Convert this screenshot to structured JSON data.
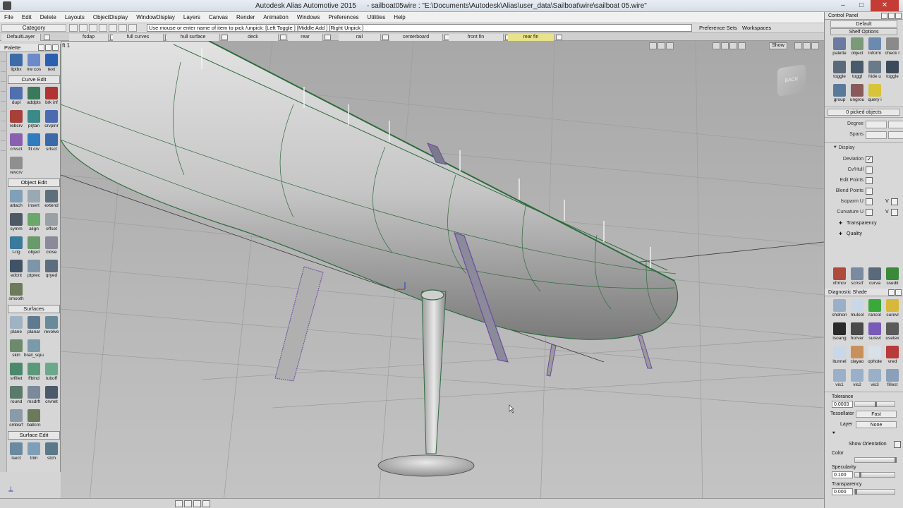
{
  "window": {
    "app_title": "Autodesk Alias Automotive 2015",
    "file_title": "- sailboat05wire : \"E:\\Documents\\Autodesk\\Alias\\user_data\\Sailboat\\wire\\sailboat 05.wire\"",
    "minimize": "–",
    "maximize": "□",
    "close": "✕"
  },
  "menu": [
    "File",
    "Edit",
    "Delete",
    "Layouts",
    "ObjectDisplay",
    "WindowDisplay",
    "Layers",
    "Canvas",
    "Render",
    "Animation",
    "Windows",
    "Preferences",
    "Utilities",
    "Help"
  ],
  "prompt_row": {
    "category": "Category",
    "prompt": "Use mouse or enter name of item to pick /unpick: [Left Toggle ] [Middle Add ] [Right Unpick ]",
    "preference_sets": "Preference Sets",
    "workspaces": "Workspaces"
  },
  "shelf_row": {
    "default_layer": "DefaultLayer",
    "tabs": [
      "fsdap",
      "full curves",
      "hull surface",
      "deck",
      "rear",
      "rail",
      "centerboard",
      "front fin",
      "rear fin"
    ],
    "active_tab": "rear fin"
  },
  "viewport": {
    "label": "ft  1",
    "show_button": "Show",
    "viewcube_label": "BACK"
  },
  "palette": {
    "title": "Palette",
    "top_tools": [
      {
        "icon": "liptbx-icon",
        "label": "liptbx",
        "color": "#3d6ba8"
      },
      {
        "icon": "nw-cos-icon",
        "label": "nw cos",
        "color": "#6b8ac9"
      },
      {
        "icon": "text-icon",
        "label": "text",
        "color": "#2b5fb0"
      }
    ],
    "sections": [
      {
        "title": "Curve Edit",
        "tools": [
          {
            "icon": "dupl-icon",
            "label": "dupl",
            "color": "#4f6fae"
          },
          {
            "icon": "addpts-icon",
            "label": "addpts",
            "color": "#3a7a5a"
          },
          {
            "icon": "brkinf-icon",
            "label": "brk inf",
            "color": "#b03434"
          },
          {
            "icon": "rebcrv-icon",
            "label": "rebcrv",
            "color": "#a8403a"
          },
          {
            "icon": "prjtan-icon",
            "label": "prjtan",
            "color": "#3b8a8a"
          },
          {
            "icon": "crvplnr-icon",
            "label": "crvplnr",
            "color": "#4a6bb0"
          },
          {
            "icon": "crvsct-icon",
            "label": "crvsct",
            "color": "#8a5fb0"
          },
          {
            "icon": "fitcrv-icon",
            "label": "fit crv",
            "color": "#2f7bbf"
          },
          {
            "icon": "srtsct-icon",
            "label": "srtsct",
            "color": "#3a6aa8"
          },
          {
            "icon": "revcrv-icon",
            "label": "revcrv",
            "color": "#8f8f8f"
          }
        ]
      },
      {
        "title": "Object Edit",
        "tools": [
          {
            "icon": "attach-icon",
            "label": "attach",
            "color": "#7fa0b8"
          },
          {
            "icon": "insert-icon",
            "label": "insert",
            "color": "#9aa8b3"
          },
          {
            "icon": "extend-icon",
            "label": "extend",
            "color": "#5e6e7a"
          },
          {
            "icon": "symm-icon",
            "label": "symm",
            "color": "#4d5a66"
          },
          {
            "icon": "align-icon",
            "label": "align",
            "color": "#6aa86a"
          },
          {
            "icon": "offset-icon",
            "label": "offset",
            "color": "#9aa0a6"
          },
          {
            "icon": "trig-icon",
            "label": "t-rig",
            "color": "#3a7a9a"
          },
          {
            "icon": "objed-icon",
            "label": "objed",
            "color": "#6a9a6a"
          },
          {
            "icon": "close-tool-icon",
            "label": "close",
            "color": "#8a8a9a"
          },
          {
            "icon": "edcnt-icon",
            "label": "edcnt",
            "color": "#3f5266"
          },
          {
            "icon": "ptprec-icon",
            "label": "ptprec",
            "color": "#7d95a8"
          },
          {
            "icon": "qryed-icon",
            "label": "qryed",
            "color": "#5d6d7d"
          },
          {
            "icon": "smooth-icon",
            "label": "smooth",
            "color": "#6e7a5a"
          }
        ]
      },
      {
        "title": "Surfaces",
        "tools": [
          {
            "icon": "plane-icon",
            "label": "plane",
            "color": "#9fb3c4"
          },
          {
            "icon": "planar-icon",
            "label": "planar",
            "color": "#5f7a8f"
          },
          {
            "icon": "revolve-icon",
            "label": "revolve",
            "color": "#6a8a9a"
          },
          {
            "icon": "skin-icon",
            "label": "skin",
            "color": "#6d8a6d"
          },
          {
            "icon": "brail-square-icon",
            "label": "brail_square",
            "color": "#7a9aaa"
          },
          {
            "icon": "blank-tool-icon",
            "label": "",
            "color": "#d6d6d6"
          },
          {
            "icon": "srfillet-icon",
            "label": "srfillet",
            "color": "#4a8a6a"
          },
          {
            "icon": "ffblnd-icon",
            "label": "ffblnd",
            "color": "#5a9a7a"
          },
          {
            "icon": "tuboff-icon",
            "label": "tuboff",
            "color": "#6aaa8a"
          },
          {
            "icon": "round-icon",
            "label": "round",
            "color": "#5a7a6a"
          },
          {
            "icon": "msdrft-icon",
            "label": "msdrft",
            "color": "#7a8a9a"
          },
          {
            "icon": "crvnet-icon",
            "label": "crvnet",
            "color": "#4a5a6a"
          },
          {
            "icon": "cmbsrf-icon",
            "label": "cmbsrf",
            "color": "#8a9aaa"
          },
          {
            "icon": "ballcrn-icon",
            "label": "ballcrn",
            "color": "#6a7a5a"
          }
        ]
      },
      {
        "title": "Surface Edit",
        "tools": [
          {
            "icon": "isect-icon",
            "label": "isect",
            "color": "#6a8aa0"
          },
          {
            "icon": "trim-icon",
            "label": "trim",
            "color": "#7f9fb8"
          },
          {
            "icon": "stch-icon",
            "label": "stch",
            "color": "#5a7a8a"
          }
        ]
      }
    ]
  },
  "control_panel": {
    "title": "Control Panel",
    "default": "Default",
    "shelf_options": "Shelf Options",
    "shelf_tools": [
      {
        "icon": "palette-icon",
        "label": "palette",
        "color": "#6a7aa0"
      },
      {
        "icon": "object-icon",
        "label": "object",
        "color": "#7a9a7a"
      },
      {
        "icon": "inform-icon",
        "label": "inform",
        "color": "#6a8ab0"
      },
      {
        "icon": "check-icon",
        "label": "check r",
        "color": "#8a8a8a"
      },
      {
        "icon": "toggle-icon",
        "label": "toggle",
        "color": "#5a6a7a"
      },
      {
        "icon": "toggl-icon",
        "label": "toggl",
        "color": "#4a5a6a"
      },
      {
        "icon": "hide-icon",
        "label": "hide u",
        "color": "#6a7a8a"
      },
      {
        "icon": "toggle2-icon",
        "label": "toggle",
        "color": "#3a4a5a"
      },
      {
        "icon": "group-icon",
        "label": "group",
        "color": "#5a7a9a"
      },
      {
        "icon": "ungroup-icon",
        "label": "ungrou",
        "color": "#8a5a5a"
      },
      {
        "icon": "query-icon",
        "label": "query i",
        "color": "#d8c43a"
      }
    ],
    "picked_objects": "0 picked objects",
    "degree": "Degree",
    "spans": "Spans",
    "display_header": "Display",
    "display_rows": [
      {
        "label": "Deviation",
        "checked": "✓"
      },
      {
        "label": "Cv/Hull",
        "checked": ""
      },
      {
        "label": "Edit Points",
        "checked": ""
      },
      {
        "label": "Blend Points",
        "checked": ""
      },
      {
        "label": "Isoparm U",
        "checked": "",
        "v": "V"
      },
      {
        "label": "Curvature U",
        "checked": "",
        "v": "V"
      }
    ],
    "transparency_sub": "Transparency",
    "quality_sub": "Quality",
    "bottom_tools": [
      {
        "icon": "xfrmcv-icon",
        "label": "xfrmcv",
        "color": "#b04a3a"
      },
      {
        "icon": "scnsrf-icon",
        "label": "scnsrf",
        "color": "#7a8aa0"
      },
      {
        "icon": "curva-icon",
        "label": "curva",
        "color": "#5a6a7a"
      },
      {
        "icon": "ssedit-icon",
        "label": "ssedit",
        "color": "#3a8a3a"
      }
    ],
    "diag_title": "Diagnostic Shade",
    "diag_tools": [
      {
        "icon": "shdnon-icon",
        "label": "shdnon",
        "color": "#9ab0c8"
      },
      {
        "icon": "mulcol-icon",
        "label": "mulcol",
        "color": "#c8d8e8"
      },
      {
        "icon": "rancol-icon",
        "label": "rancol",
        "color": "#3aa83a"
      },
      {
        "icon": "curevl-icon",
        "label": "curevl",
        "color": "#d8b83a"
      },
      {
        "icon": "isoang-icon",
        "label": "isoang",
        "color": "#2a2a2a"
      },
      {
        "icon": "horver-icon",
        "label": "horver",
        "color": "#4a4a4a"
      },
      {
        "icon": "surevl-icon",
        "label": "surevl",
        "color": "#7a5ab8"
      },
      {
        "icon": "usetex-icon",
        "label": "usetex",
        "color": "#5a5a5a"
      },
      {
        "icon": "ltunnel-icon",
        "label": "ltunnel",
        "color": "#c8d8e8"
      },
      {
        "icon": "clayao-icon",
        "label": "clayao",
        "color": "#c8905a"
      },
      {
        "icon": "ophote-icon",
        "label": "ophote",
        "color": "#d8e0e8"
      },
      {
        "icon": "vred-icon",
        "label": "vred",
        "color": "#b83a3a"
      },
      {
        "icon": "vis1-icon",
        "label": "vis1",
        "color": "#9ab0c8"
      },
      {
        "icon": "vis2-icon",
        "label": "vis2",
        "color": "#9ab0c8"
      },
      {
        "icon": "vis3-icon",
        "label": "vis3",
        "color": "#9ab0c8"
      },
      {
        "icon": "fillest-icon",
        "label": "fillest",
        "color": "#8aa0b8"
      }
    ],
    "tolerance_label": "Tolerance",
    "tolerance_value": "0.0003",
    "tessellator_label": "Tessellator",
    "tessellator_value": "Fast",
    "layer_label": "Layer",
    "layer_value": "None",
    "show_orientation": "Show Orientation",
    "color_label": "Color",
    "specularity_label": "Specularity",
    "specularity_value": "0.100",
    "transparency_label": "Transparency",
    "transparency_value": "0.000"
  },
  "colors": {
    "viewport_bg": "#b9b9b9",
    "wire_green": "#2e6b3c",
    "active_shelf": "#e9e28a",
    "fin_purple": "#6e4aa0"
  }
}
